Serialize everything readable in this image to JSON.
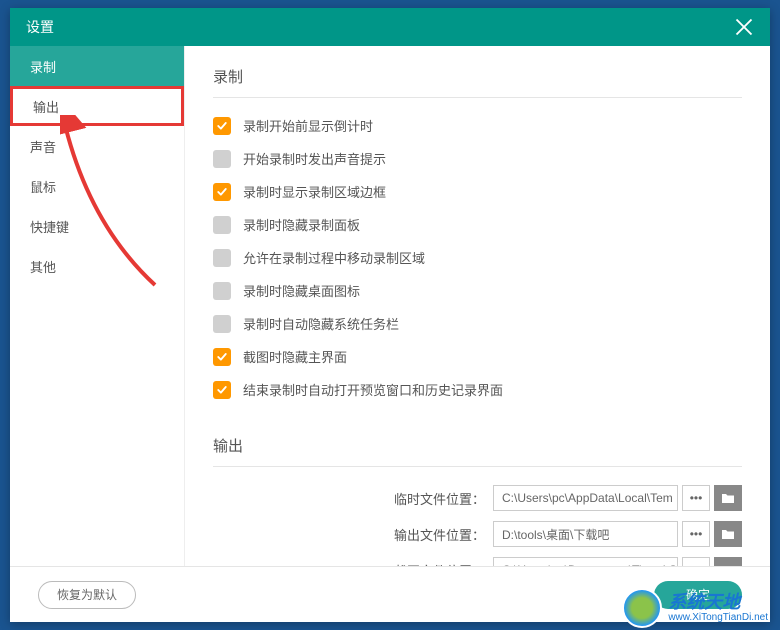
{
  "titlebar": {
    "title": "设置"
  },
  "sidebar": {
    "items": [
      {
        "label": "录制",
        "active": true
      },
      {
        "label": "输出",
        "highlighted": true
      },
      {
        "label": "声音"
      },
      {
        "label": "鼠标"
      },
      {
        "label": "快捷键"
      },
      {
        "label": "其他"
      }
    ]
  },
  "sections": {
    "recording": {
      "title": "录制",
      "options": [
        {
          "label": "录制开始前显示倒计时",
          "checked": true
        },
        {
          "label": "开始录制时发出声音提示",
          "checked": false
        },
        {
          "label": "录制时显示录制区域边框",
          "checked": true
        },
        {
          "label": "录制时隐藏录制面板",
          "checked": false
        },
        {
          "label": "允许在录制过程中移动录制区域",
          "checked": false
        },
        {
          "label": "录制时隐藏桌面图标",
          "checked": false
        },
        {
          "label": "录制时自动隐藏系统任务栏",
          "checked": false
        },
        {
          "label": "截图时隐藏主界面",
          "checked": true
        },
        {
          "label": "结束录制时自动打开预览窗口和历史记录界面",
          "checked": true
        }
      ]
    },
    "output": {
      "title": "输出",
      "paths": [
        {
          "label": "临时文件位置：",
          "value": "C:\\Users\\pc\\AppData\\Local\\Tem"
        },
        {
          "label": "输出文件位置：",
          "value": "D:\\tools\\桌面\\下载吧"
        },
        {
          "label": "截图文件位置：",
          "value": "C:\\Users\\pc\\Documents\\Tipard S"
        }
      ]
    }
  },
  "footer": {
    "restore": "恢复为默认",
    "confirm": "确定"
  },
  "watermark": {
    "cn": "系统天地",
    "url": "www.XiTongTianDi.net"
  }
}
